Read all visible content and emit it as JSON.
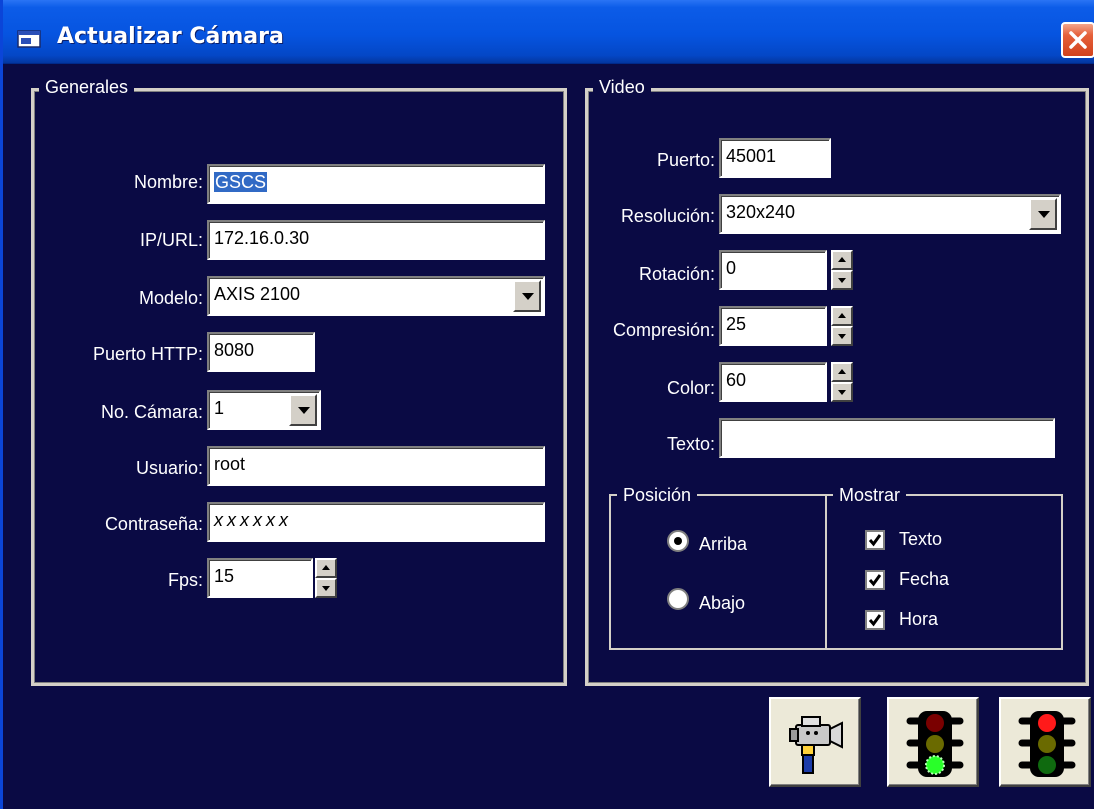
{
  "window": {
    "title": "Actualizar Cámara",
    "icon": "window-app-icon",
    "close_icon": "close-icon"
  },
  "generales": {
    "legend": "Generales",
    "nombre": {
      "label": "Nombre:",
      "value": "GSCS"
    },
    "ip": {
      "label": "IP/URL:",
      "value": "172.16.0.30"
    },
    "modelo": {
      "label": "Modelo:",
      "value": "AXIS 2100"
    },
    "puerto_http": {
      "label": "Puerto HTTP:",
      "value": "8080"
    },
    "no_camara": {
      "label": "No. Cámara:",
      "value": "1"
    },
    "usuario": {
      "label": "Usuario:",
      "value": "root"
    },
    "contrasena": {
      "label": "Contraseña:",
      "value": "xxxxxx"
    },
    "fps": {
      "label": "Fps:",
      "value": "15"
    }
  },
  "video": {
    "legend": "Video",
    "puerto": {
      "label": "Puerto:",
      "value": "45001"
    },
    "resolucion": {
      "label": "Resolución:",
      "value": "320x240"
    },
    "rotacion": {
      "label": "Rotación:",
      "value": "0"
    },
    "compresion": {
      "label": "Compresión:",
      "value": "25"
    },
    "color": {
      "label": "Color:",
      "value": "60"
    },
    "texto": {
      "label": "Texto:",
      "value": ""
    },
    "posicion": {
      "legend": "Posición",
      "options": [
        {
          "label": "Arriba",
          "selected": true
        },
        {
          "label": "Abajo",
          "selected": false
        }
      ]
    },
    "mostrar": {
      "legend": "Mostrar",
      "options": [
        {
          "label": "Texto",
          "checked": true
        },
        {
          "label": "Fecha",
          "checked": true
        },
        {
          "label": "Hora",
          "checked": true
        }
      ]
    }
  },
  "buttons": [
    {
      "icon": "video-camera-icon"
    },
    {
      "icon": "traffic-light-green-icon"
    },
    {
      "icon": "traffic-light-red-icon"
    }
  ],
  "colors": {
    "background": "#0a0a44",
    "title_bar": "#0654e0",
    "selection": "#316ac5"
  }
}
